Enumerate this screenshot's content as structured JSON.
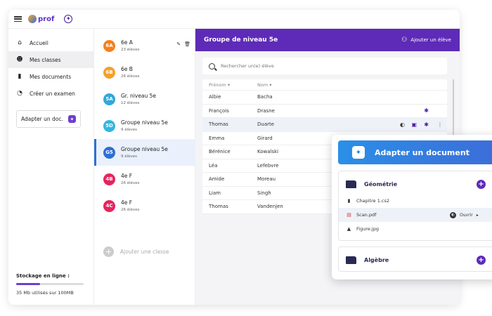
{
  "app": {
    "logo_text": "prof"
  },
  "sidebar": {
    "items": [
      {
        "label": "Accueil",
        "icon": "home-icon",
        "glyph": "⌂"
      },
      {
        "label": "Mes classes",
        "icon": "people-icon",
        "glyph": "👥"
      },
      {
        "label": "Mes documents",
        "icon": "document-icon",
        "glyph": "▮"
      },
      {
        "label": "Créer un examen",
        "icon": "timer-icon",
        "glyph": "⏱"
      }
    ],
    "adapt_label": "Adapter un doc.",
    "storage_title": "Stockage en ligne :",
    "storage_used_fraction": 0.35,
    "storage_text": "35 Mb utilisés sur 100MB"
  },
  "classes": {
    "items": [
      {
        "code": "6A",
        "name": "6e A",
        "count": "23 élèves",
        "color": "#f5801e"
      },
      {
        "code": "6B",
        "name": "6e B",
        "count": "26 élèves",
        "color": "#f5a12a"
      },
      {
        "code": "5A",
        "name": "Gr. niveau 5e",
        "count": "12 élèves",
        "color": "#33a7d8"
      },
      {
        "code": "5D",
        "name": "Groupe niveau 5e",
        "count": "9 élèves",
        "color": "#33b6e0"
      },
      {
        "code": "G5",
        "name": "Groupe niveau 5e",
        "count": "9 élèves",
        "color": "#2d6fd6"
      },
      {
        "code": "4B",
        "name": "4e F",
        "count": "26 élèves",
        "color": "#e6245e"
      },
      {
        "code": "4C",
        "name": "4e F",
        "count": "26 élèves",
        "color": "#e6245e"
      }
    ],
    "add_label": "Ajouter une classe"
  },
  "main": {
    "title": "Groupe de niveau 5e",
    "add_student_label": "Ajouter un élève",
    "search_placeholder": "Rechercher un(e) élève",
    "col_firstname": "Prénom",
    "col_lastname": "Nom",
    "rows": [
      {
        "first": "Albie",
        "last": "Bacha"
      },
      {
        "first": "François",
        "last": "Drasne"
      },
      {
        "first": "Thomas",
        "last": "Duarte"
      },
      {
        "first": "Emma",
        "last": "Girard"
      },
      {
        "first": "Bérénice",
        "last": "Kowalski"
      },
      {
        "first": "Léa",
        "last": "Lefebvre"
      },
      {
        "first": "Amide",
        "last": "Moreau"
      },
      {
        "first": "Liam",
        "last": "Singh"
      },
      {
        "first": "Thomas",
        "last": "Vandenjen"
      }
    ]
  },
  "overlay": {
    "title": "Adapter un document",
    "folder1": "Géométrie",
    "files": [
      {
        "name": "Chapitre 1.cs2",
        "icon": "file-icon"
      },
      {
        "name": "Scan.pdf",
        "icon": "pdf-icon"
      },
      {
        "name": "Figure.jpg",
        "icon": "image-icon"
      }
    ],
    "open_label": "Ouvrir",
    "folder2": "Algèbre"
  }
}
